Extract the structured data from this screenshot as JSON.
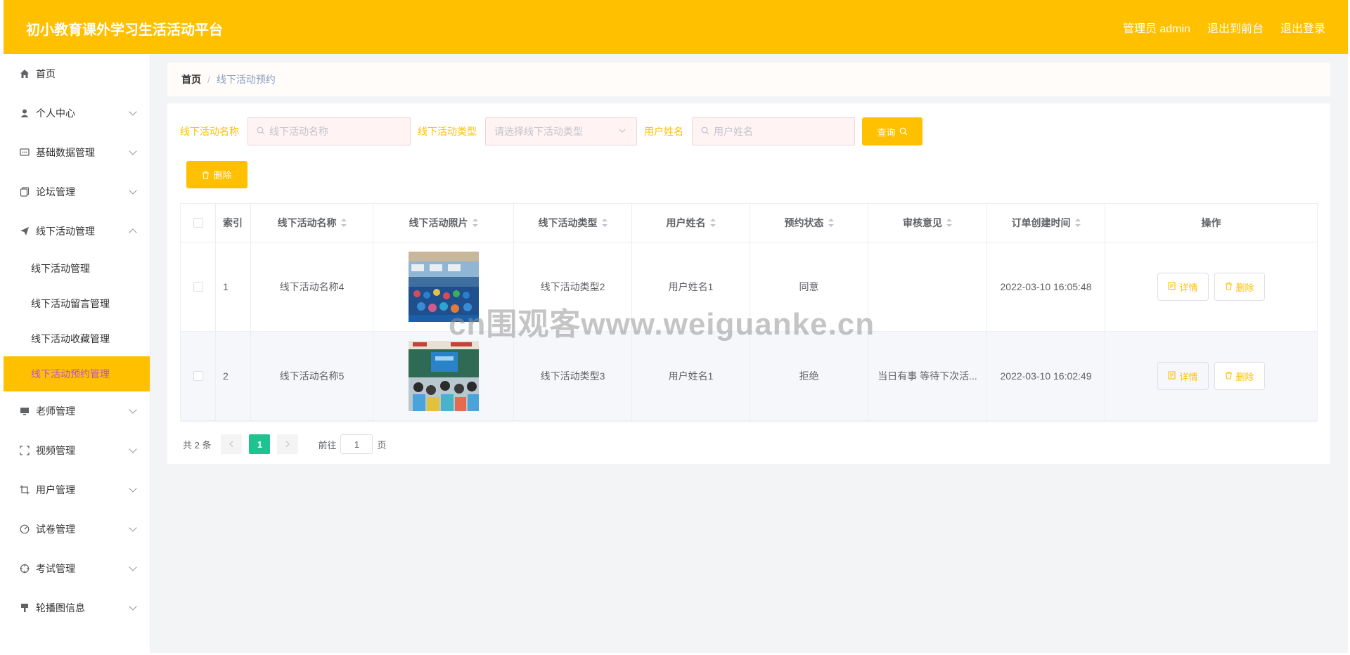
{
  "header": {
    "title": "初小教育课外学习生活活动平台",
    "admin_label": "管理员 admin",
    "back_label": "退出到前台",
    "logout_label": "退出登录"
  },
  "sidebar": {
    "items": [
      {
        "label": "首页",
        "icon": "home-icon"
      },
      {
        "label": "个人中心",
        "icon": "user-icon"
      },
      {
        "label": "基础数据管理",
        "icon": "message-icon"
      },
      {
        "label": "论坛管理",
        "icon": "copy-icon"
      },
      {
        "label": "线下活动管理",
        "icon": "send-icon",
        "expanded": true,
        "children": [
          "线下活动管理",
          "线下活动留言管理",
          "线下活动收藏管理",
          "线下活动预约管理"
        ]
      },
      {
        "label": "老师管理",
        "icon": "monitor-icon"
      },
      {
        "label": "视频管理",
        "icon": "fullscreen-icon"
      },
      {
        "label": "用户管理",
        "icon": "crop-icon"
      },
      {
        "label": "试卷管理",
        "icon": "gauge-icon"
      },
      {
        "label": "考试管理",
        "icon": "target-icon"
      },
      {
        "label": "轮播图信息",
        "icon": "brush-icon"
      }
    ],
    "active_child": "线下活动预约管理"
  },
  "breadcrumb": {
    "home": "首页",
    "separator": "/",
    "current": "线下活动预约"
  },
  "search": {
    "name_label": "线下活动名称",
    "name_placeholder": "线下活动名称",
    "type_label": "线下活动类型",
    "type_placeholder": "请选择线下活动类型",
    "user_label": "用户姓名",
    "user_placeholder": "用户姓名",
    "query_label": "查询"
  },
  "toolbar": {
    "delete_label": "删除"
  },
  "table": {
    "headers": [
      "索引",
      "线下活动名称",
      "线下活动照片",
      "线下活动类型",
      "用户姓名",
      "预约状态",
      "审核意见",
      "订单创建时间",
      "操作"
    ],
    "rows": [
      {
        "index": "1",
        "name": "线下活动名称4",
        "type": "线下活动类型2",
        "user": "用户姓名1",
        "status": "同意",
        "opinion": "",
        "time": "2022-03-10 16:05:48"
      },
      {
        "index": "2",
        "name": "线下活动名称5",
        "type": "线下活动类型3",
        "user": "用户姓名1",
        "status": "拒绝",
        "opinion": "当日有事 等待下次活...",
        "time": "2022-03-10 16:02:49"
      }
    ],
    "detail_label": "详情",
    "delete_label": "删除"
  },
  "pager": {
    "total": "共 2 条",
    "current_page": "1",
    "goto_label": "前往",
    "goto_value": "1",
    "page_suffix": "页"
  },
  "watermark": "cn围观客www.weiguanke.cn",
  "colors": {
    "accent": "#ffc000",
    "active_page": "#1fc392",
    "active_text": "#c04fd0"
  }
}
